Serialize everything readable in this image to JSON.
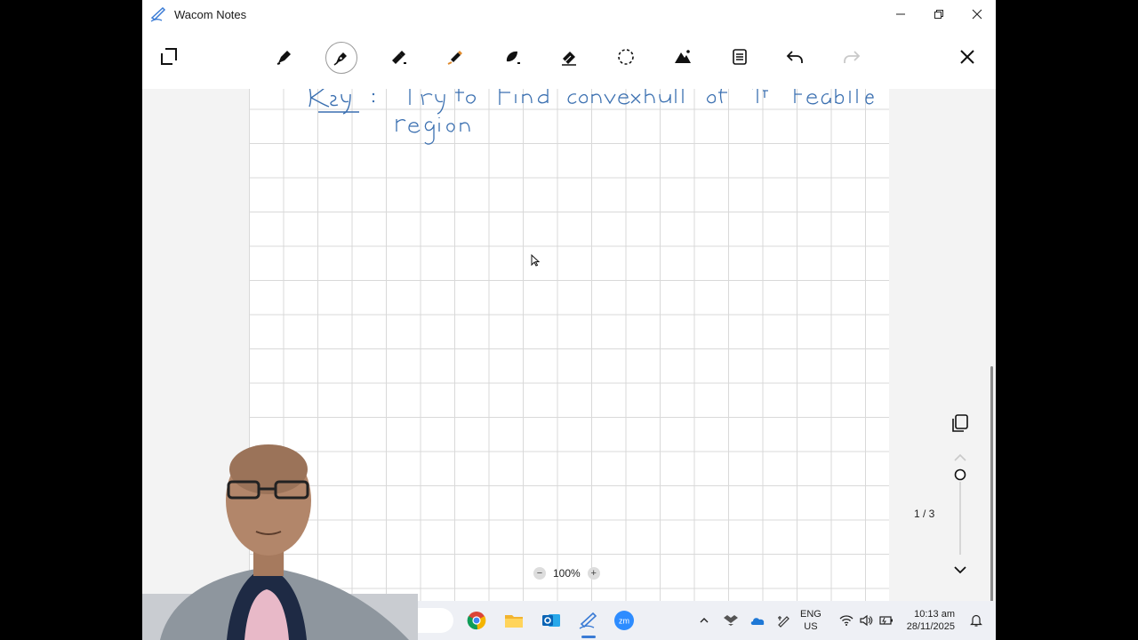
{
  "window": {
    "title": "Wacom Notes",
    "controls": [
      "minimize-icon",
      "restore-icon",
      "close-icon"
    ]
  },
  "toolbar": {
    "tools": [
      {
        "name": "pages-icon"
      },
      {
        "name": "pen-icon"
      },
      {
        "name": "fountain-pen-icon",
        "active": true
      },
      {
        "name": "marker-icon"
      },
      {
        "name": "highlighter-icon"
      },
      {
        "name": "brush-icon"
      },
      {
        "name": "eraser-icon"
      },
      {
        "name": "lasso-icon"
      },
      {
        "name": "image-icon"
      },
      {
        "name": "notes-icon"
      },
      {
        "name": "undo-icon"
      },
      {
        "name": "redo-icon",
        "disabled": true
      },
      {
        "name": "close-icon"
      }
    ]
  },
  "canvas": {
    "handwriting_line1": "Key: Try to find convex hull of 1ᵗ feasible",
    "handwriting_line2": "region",
    "ink_color": "#3a6fb0"
  },
  "navigation": {
    "page_counter": "1 / 3",
    "page_position_fraction": 0.0
  },
  "zoom": {
    "minus": "−",
    "level": "100%",
    "plus": "+"
  },
  "taskbar": {
    "apps": [
      "chrome-icon",
      "file-explorer-icon",
      "outlook-icon",
      "wacom-notes-icon",
      "zoom-icon"
    ],
    "tray": [
      "chevron-up-icon",
      "dropbox-icon",
      "onedrive-icon",
      "pen-tray-icon"
    ],
    "language_line1": "ENG",
    "language_line2": "US",
    "tray_status": [
      "wifi-icon",
      "volume-icon",
      "battery-icon"
    ],
    "time": "10:13 am",
    "date": "28/11/2025",
    "notification": "notification-icon"
  },
  "colors": {
    "accent": "#3a6fb0",
    "window_bg": "#f3f3f3",
    "taskbar_bg": "#eef0f5"
  }
}
